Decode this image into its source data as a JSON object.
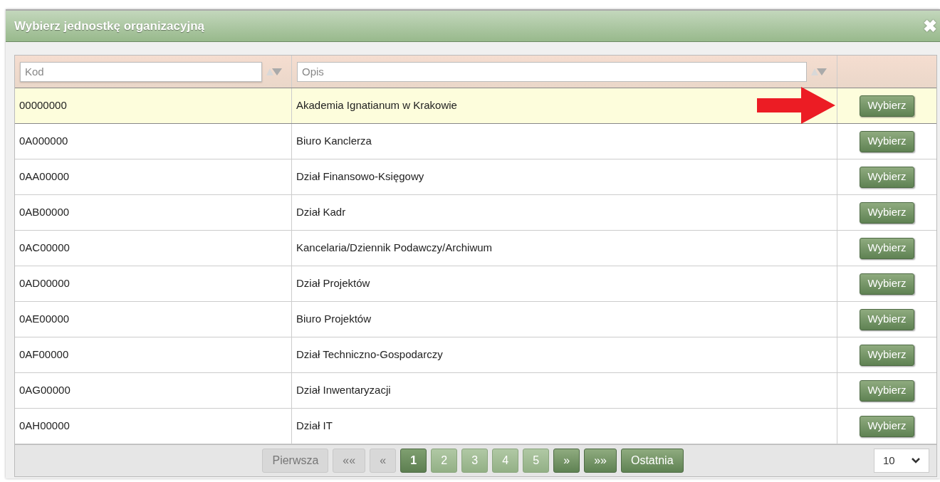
{
  "dialog": {
    "title": "Wybierz jednostkę organizacyjną",
    "close": "✖"
  },
  "filters": [
    {
      "placeholder": "Kod"
    },
    {
      "placeholder": "Opis"
    }
  ],
  "rows": [
    {
      "code": "00000000",
      "description": "Akademia Ignatianum w Krakowie",
      "action": "Wybierz",
      "selected": true,
      "pointer_arrow": true
    },
    {
      "code": "0A000000",
      "description": "Biuro Kanclerza",
      "action": "Wybierz",
      "selected": false,
      "pointer_arrow": false
    },
    {
      "code": "0AA00000",
      "description": "Dział Finansowo-Księgowy",
      "action": "Wybierz",
      "selected": false,
      "pointer_arrow": false
    },
    {
      "code": "0AB00000",
      "description": "Dział Kadr",
      "action": "Wybierz",
      "selected": false,
      "pointer_arrow": false
    },
    {
      "code": "0AC00000",
      "description": "Kancelaria/Dziennik Podawczy/Archiwum",
      "action": "Wybierz",
      "selected": false,
      "pointer_arrow": false
    },
    {
      "code": "0AD00000",
      "description": "Dział Projektów",
      "action": "Wybierz",
      "selected": false,
      "pointer_arrow": false
    },
    {
      "code": "0AE00000",
      "description": "Biuro Projektów",
      "action": "Wybierz",
      "selected": false,
      "pointer_arrow": false
    },
    {
      "code": "0AF00000",
      "description": "Dział Techniczno-Gospodarczy",
      "action": "Wybierz",
      "selected": false,
      "pointer_arrow": false
    },
    {
      "code": "0AG00000",
      "description": "Dział Inwentaryzacji",
      "action": "Wybierz",
      "selected": false,
      "pointer_arrow": false
    },
    {
      "code": "0AH00000",
      "description": "Dział IT",
      "action": "Wybierz",
      "selected": false,
      "pointer_arrow": false
    }
  ],
  "pagination": [
    {
      "label": "Pierwsza",
      "kind": "nav",
      "disabled": true,
      "selected": false
    },
    {
      "label": "««",
      "kind": "nav",
      "disabled": true,
      "selected": false
    },
    {
      "label": "«",
      "kind": "nav",
      "disabled": true,
      "selected": false
    },
    {
      "label": "1",
      "kind": "page",
      "disabled": false,
      "selected": true
    },
    {
      "label": "2",
      "kind": "page",
      "disabled": false,
      "selected": false
    },
    {
      "label": "3",
      "kind": "page",
      "disabled": false,
      "selected": false
    },
    {
      "label": "4",
      "kind": "page",
      "disabled": false,
      "selected": false
    },
    {
      "label": "5",
      "kind": "page",
      "disabled": false,
      "selected": false
    },
    {
      "label": "»",
      "kind": "nav",
      "disabled": false,
      "selected": false
    },
    {
      "label": "»»",
      "kind": "nav",
      "disabled": false,
      "selected": false
    },
    {
      "label": "Ostatnia",
      "kind": "nav",
      "disabled": false,
      "selected": false
    }
  ],
  "page_size": "10"
}
